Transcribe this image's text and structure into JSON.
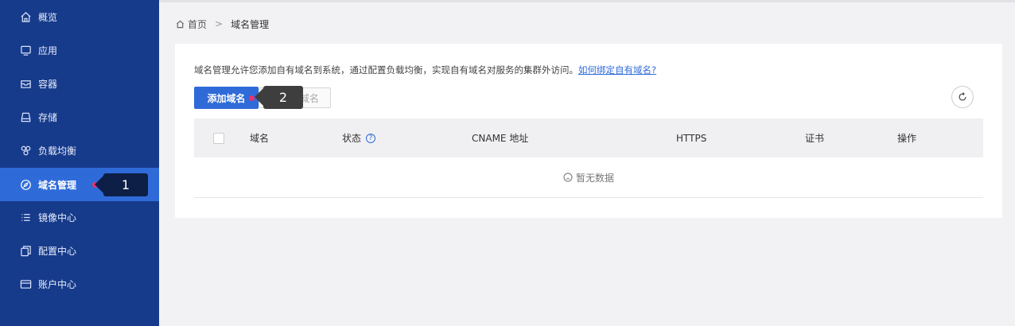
{
  "sidebar": {
    "items": [
      {
        "label": "概览",
        "icon": "home-icon"
      },
      {
        "label": "应用",
        "icon": "monitor-icon"
      },
      {
        "label": "容器",
        "icon": "box-icon"
      },
      {
        "label": "存储",
        "icon": "storage-icon"
      },
      {
        "label": "负载均衡",
        "icon": "load-balancer-icon"
      },
      {
        "label": "域名管理",
        "icon": "compass-icon",
        "active": true
      },
      {
        "label": "镜像中心",
        "icon": "list-icon"
      },
      {
        "label": "配置中心",
        "icon": "copy-icon"
      },
      {
        "label": "账户中心",
        "icon": "card-icon"
      }
    ]
  },
  "breadcrumb": {
    "home": "首页",
    "separator": ">",
    "current": "域名管理"
  },
  "main": {
    "description": "域名管理允许您添加自有域名到系统，通过配置负载均衡，实现自有域名对服务的集群外访问。",
    "help_link": "如何绑定自有域名?",
    "add_button": "添加域名",
    "delete_button": "删除域名",
    "table": {
      "columns": [
        "域名",
        "状态",
        "CNAME 地址",
        "HTTPS",
        "证书",
        "操作"
      ],
      "empty_text": "暂无数据"
    }
  },
  "annotations": {
    "marker1": "1",
    "marker2": "2"
  },
  "colors": {
    "sidebar": "#173b8b",
    "active": "#2f6bd8",
    "primary": "#2f6bd8",
    "marker_dot": "#e8336c"
  }
}
